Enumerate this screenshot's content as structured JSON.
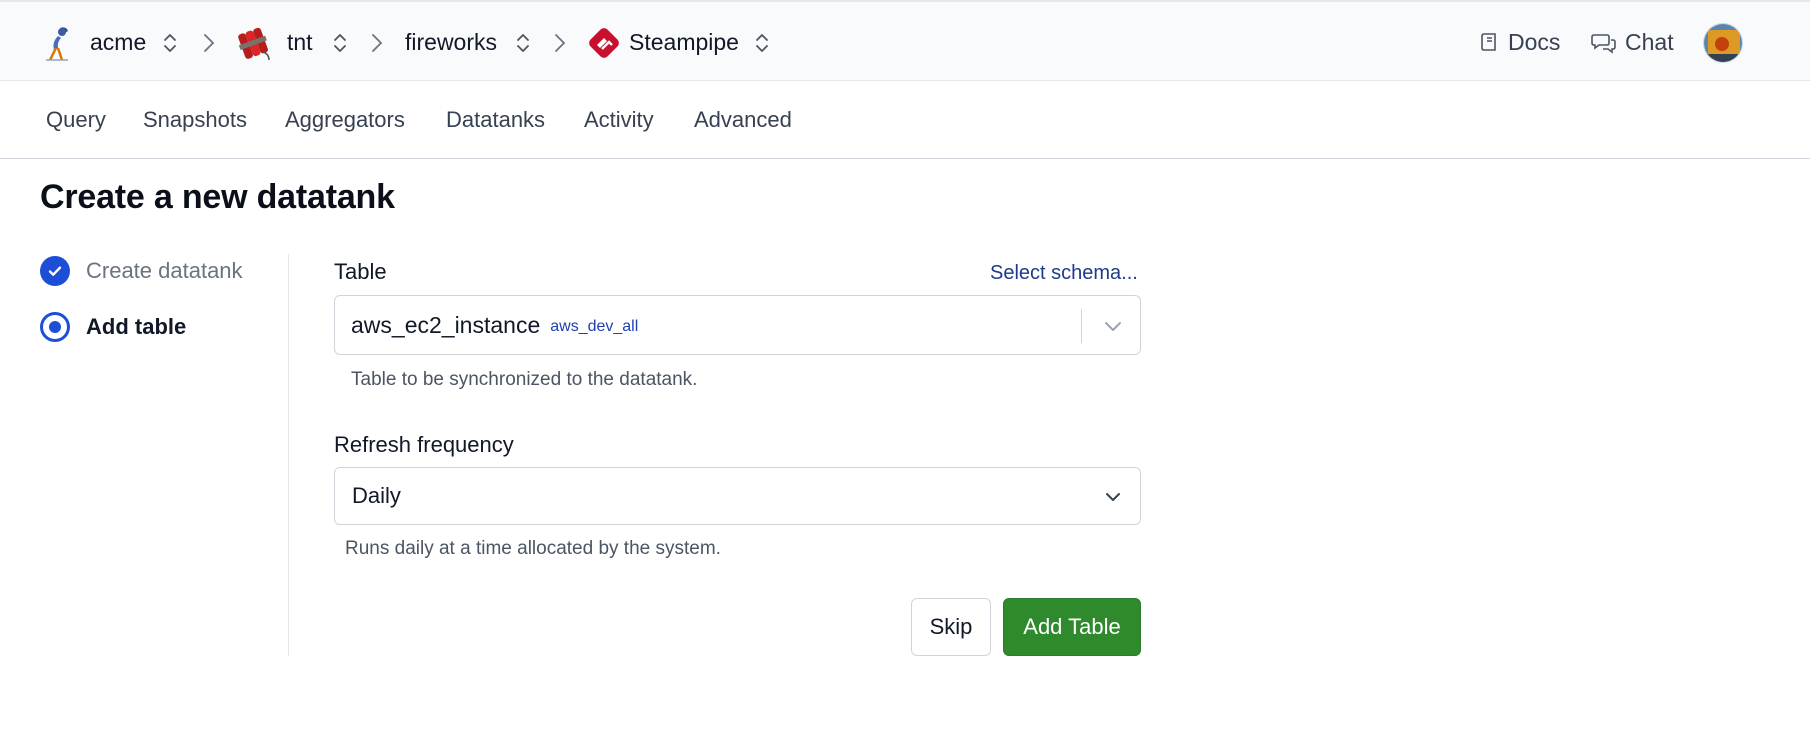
{
  "breadcrumb": {
    "items": [
      {
        "label": "acme",
        "icon": "roadrunner-logo-icon"
      },
      {
        "label": "tnt",
        "icon": "tnt-logo-icon"
      },
      {
        "label": "fireworks",
        "icon": null
      },
      {
        "label": "Steampipe",
        "icon": "steampipe-logo-icon"
      }
    ]
  },
  "header": {
    "docs_label": "Docs",
    "chat_label": "Chat"
  },
  "tabs": [
    {
      "label": "Query"
    },
    {
      "label": "Snapshots"
    },
    {
      "label": "Aggregators"
    },
    {
      "label": "Datatanks"
    },
    {
      "label": "Activity"
    },
    {
      "label": "Advanced"
    }
  ],
  "page": {
    "title": "Create a new datatank"
  },
  "steps": [
    {
      "label": "Create datatank",
      "state": "complete"
    },
    {
      "label": "Add table",
      "state": "current"
    }
  ],
  "form": {
    "table": {
      "label": "Table",
      "select_schema_link": "Select schema...",
      "value": "aws_ec2_instance",
      "schema": "aws_dev_all",
      "help": "Table to be synchronized to the datatank."
    },
    "refresh": {
      "label": "Refresh frequency",
      "value": "Daily",
      "help": "Runs daily at a time allocated by the system."
    },
    "skip_label": "Skip",
    "add_label": "Add Table"
  },
  "colors": {
    "accent": "#1d4ed8",
    "primary_button": "#2f8a2d",
    "link": "#1e3a8a"
  }
}
